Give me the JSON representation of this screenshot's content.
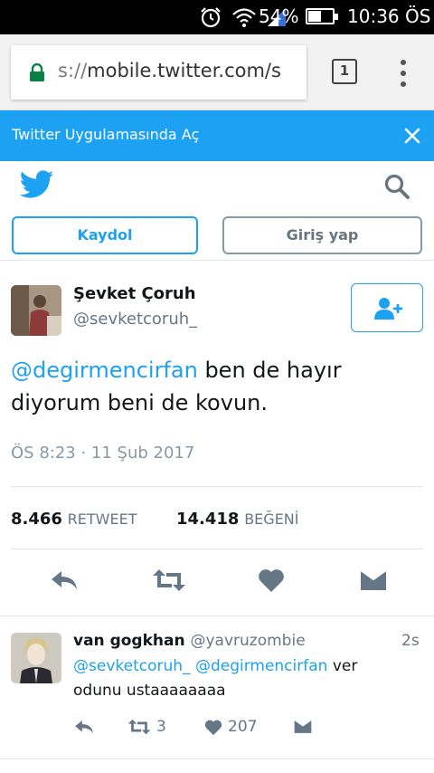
{
  "status_bar": {
    "battery": "54%",
    "battery_level": 0.54,
    "time": "10:36 ÖS",
    "icons": [
      "alarm-icon",
      "wifi-icon",
      "signal-icon"
    ]
  },
  "browser": {
    "url_scheme": "s://",
    "url_host": "mobile.twitter.com/s",
    "tab_count": "1"
  },
  "banner": {
    "text": "Twitter Uygulamasında Aç"
  },
  "header": {
    "signup_label": "Kaydol",
    "login_label": "Giriş yap"
  },
  "tweet": {
    "author_name": "Şevket Çoruh",
    "author_handle": "@sevketcoruh_",
    "mention": "@degirmencirfan",
    "body": " ben de hayır diyorum beni de kovun.",
    "time": "ÖS 8:23 · 11 Şub 2017",
    "retweet_count": "8.466",
    "retweet_label": "RETWEET",
    "like_count": "14.418",
    "like_label": "BEĞENİ"
  },
  "reply": {
    "author_name": "van gogkhan",
    "author_handle": "@yavruzombie",
    "age": "2s",
    "mention_1": "@sevketcoruh_",
    "mention_2": "@degirmencirfan",
    "body": " ver odunu ustaaaaaaaa",
    "retweet_count": "3",
    "like_count": "207"
  },
  "colors": {
    "accent": "#1da1f2",
    "muted": "#657786",
    "lock_green": "#0b8043"
  }
}
